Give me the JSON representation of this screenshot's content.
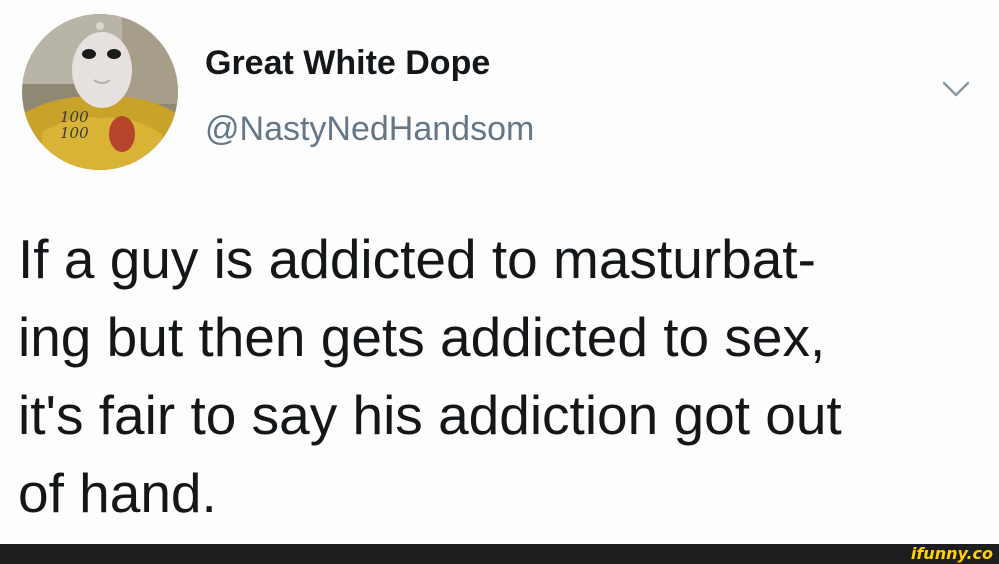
{
  "tweet": {
    "avatar_icon": "user-avatar-photo",
    "display_name": "Great White Dope",
    "handle": "@NastyNedHandsom",
    "caret_icon": "chevron-down-icon",
    "text_lines": [
      "If a guy is addicted to masturbat-",
      "ing but then gets addicted to sex,",
      "it's fair to say his addiction got out",
      "of hand."
    ]
  },
  "footer": {
    "watermark": "ifunny.co",
    "watermark_color": "#ffd200"
  }
}
